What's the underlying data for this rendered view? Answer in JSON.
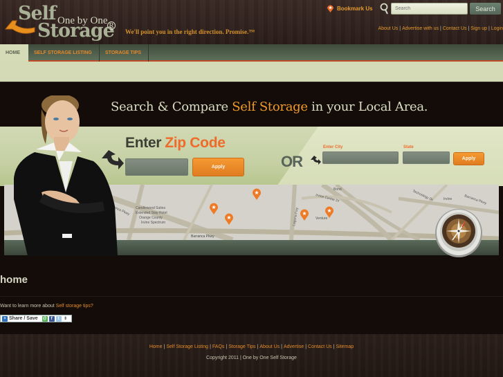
{
  "header": {
    "logo": {
      "word1": "Self",
      "word2": "Storage",
      "subtitle": "One by One",
      "registered": "R"
    },
    "tagline": "We'll point you in the right direction. Promise.™",
    "bookmark_label": "Bookmark Us",
    "search": {
      "placeholder": "Search",
      "value": "",
      "button_label": "Search"
    },
    "top_links": [
      "About Us",
      "Advertise with us",
      "Contact Us",
      "Sign up",
      "Login"
    ]
  },
  "nav": {
    "tabs": [
      {
        "label": "HOME",
        "active": true
      },
      {
        "label": "SELF STORAGE LISTING",
        "active": false
      },
      {
        "label": "STORAGE TIPS",
        "active": false
      }
    ]
  },
  "hero": {
    "title_pre": "Search & Compare ",
    "title_highlight": "Self Storage",
    "title_post": " in your Local Area.",
    "zip": {
      "heading_pre": "Enter",
      "heading_highlight": "Zip Code",
      "value": "",
      "apply_label": "Apply"
    },
    "or_label": "OR",
    "city": {
      "label": "Enter City",
      "value": ""
    },
    "state": {
      "label": "State",
      "value": ""
    },
    "city_apply_label": "Apply",
    "map_labels": [
      "Barranca Pkwy",
      "Candlewood Suites",
      "Extended Stay Hotel",
      "Orange County",
      "Irvine Spectrum",
      "Laguna Fwy",
      "Irvine Center Dr",
      "Bond",
      "Venture",
      "Technology Dr",
      "Irvine",
      "Barranca Pkwy"
    ]
  },
  "content": {
    "heading": "home",
    "intro_text": "Want to learn more about ",
    "intro_link": "Self storage tips?",
    "share_label": "Share / Save"
  },
  "colors": {
    "accent_orange": "#e39a2e",
    "nav_green": "#4c5a49",
    "band_green": "#d1d9b4",
    "background": "#140c08"
  },
  "footer": {
    "links": [
      "Home",
      "Self Storage Listing",
      "FAQs",
      "Storage Tips",
      "About Us",
      "Advertise",
      "Contact Us",
      "Sitemap"
    ],
    "copyright": "Copyright 2011 | One by One Self Storage"
  }
}
